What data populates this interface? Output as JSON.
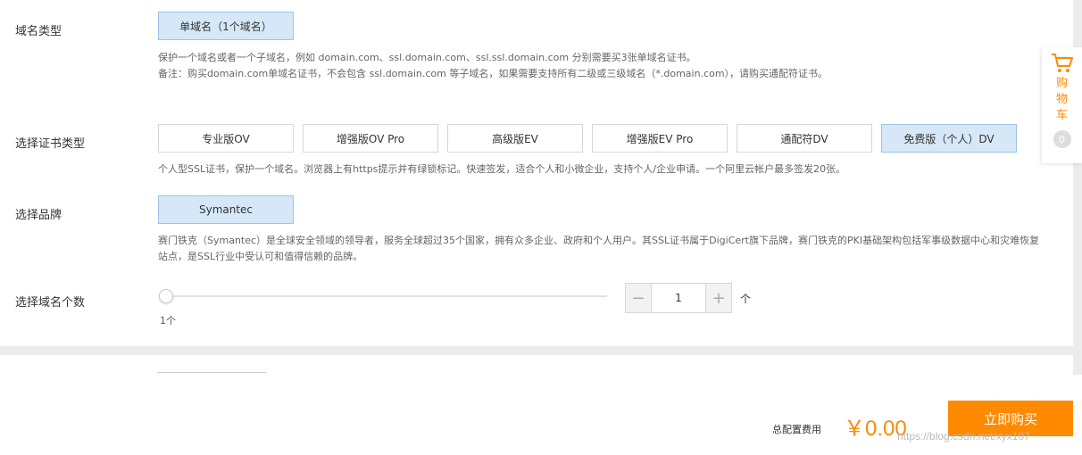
{
  "domain_type": {
    "label": "域名类型",
    "options": [
      "单域名（1个域名）"
    ],
    "selected_index": 0,
    "desc_line1": "保护一个域名或者一个子域名，例如 domain.com、ssl.domain.com、ssl.ssl.domain.com 分别需要买3张单域名证书。",
    "desc_line2": "备注：购买domain.com单域名证书，不会包含 ssl.domain.com 等子域名，如果需要支持所有二级或三级域名（*.domain.com），请购买通配符证书。"
  },
  "cert_type": {
    "label": "选择证书类型",
    "options": [
      "专业版OV",
      "增强版OV Pro",
      "高级版EV",
      "增强版EV Pro",
      "通配符DV",
      "免费版（个人）DV"
    ],
    "selected_index": 5,
    "desc": "个人型SSL证书，保护一个域名。浏览器上有https提示并有绿锁标记。快速签发，适合个人和小微企业，支持个人/企业申请。一个阿里云帐户最多签发20张。"
  },
  "brand": {
    "label": "选择品牌",
    "options": [
      "Symantec"
    ],
    "selected_index": 0,
    "desc": "赛门铁克（Symantec）是全球安全领域的领导者，服务全球超过35个国家，拥有众多企业、政府和个人用户。其SSL证书属于DigiCert旗下品牌，赛门铁克的PKI基础架构包括军事级数据中心和灾难恢复站点，是SSL行业中受认可和值得信赖的品牌。"
  },
  "domain_count": {
    "label": "选择域名个数",
    "slider_min_label": "1个",
    "slider_value_fraction": 0,
    "stepper_value": "1",
    "minus": "−",
    "plus": "+",
    "unit": "个"
  },
  "cart": {
    "text": "购物车",
    "count": "0",
    "accent": "#ff8a00"
  },
  "footer": {
    "total_label": "总配置费用",
    "total_price": "￥0.00",
    "buy_label": "立即购买",
    "watermark": "https://blog.csdn.net/xyx107",
    "accent": "#ff8a00"
  }
}
